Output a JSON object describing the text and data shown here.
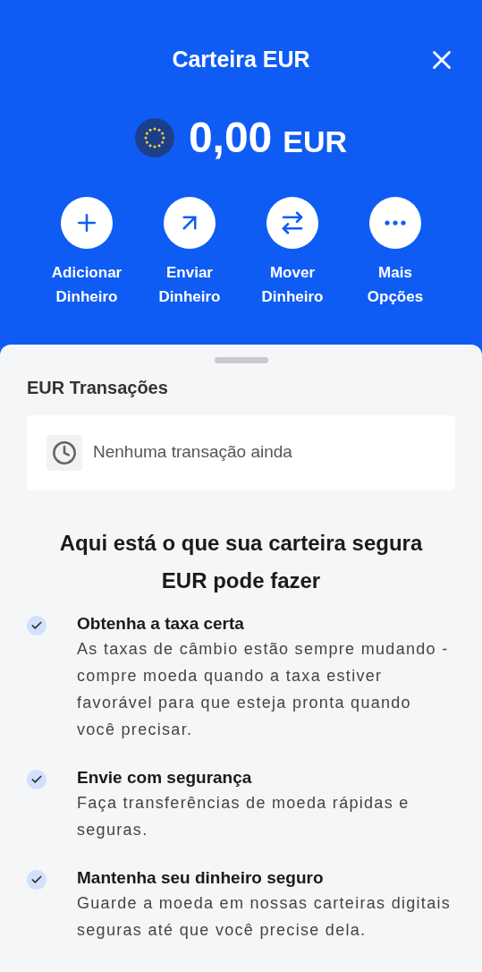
{
  "header": {
    "title": "Carteira EUR"
  },
  "balance": {
    "amount": "0,00",
    "currency": "EUR"
  },
  "actions": [
    {
      "kind": "add",
      "label": "Adicionar Dinheiro"
    },
    {
      "kind": "send",
      "label": "Enviar Dinheiro"
    },
    {
      "kind": "move",
      "label": "Mover Dinheiro"
    },
    {
      "kind": "more",
      "label": "Mais Opções"
    }
  ],
  "transactions": {
    "title": "EUR Transações",
    "empty_message": "Nenhuma transação ainda"
  },
  "features": {
    "title": "Aqui está o que sua carteira segura EUR pode fazer",
    "items": [
      {
        "title": "Obtenha a taxa certa",
        "text": "As taxas de câmbio estão sempre mudando - compre moeda quando a taxa estiver favorável para que esteja pronta quando você precisar."
      },
      {
        "title": "Envie com segurança",
        "text": "Faça transferências de moeda rápidas e seguras."
      },
      {
        "title": "Mantenha seu dinheiro seguro",
        "text": "Guarde a moeda em nossas carteiras digitais seguras até que você precise dela."
      }
    ]
  }
}
